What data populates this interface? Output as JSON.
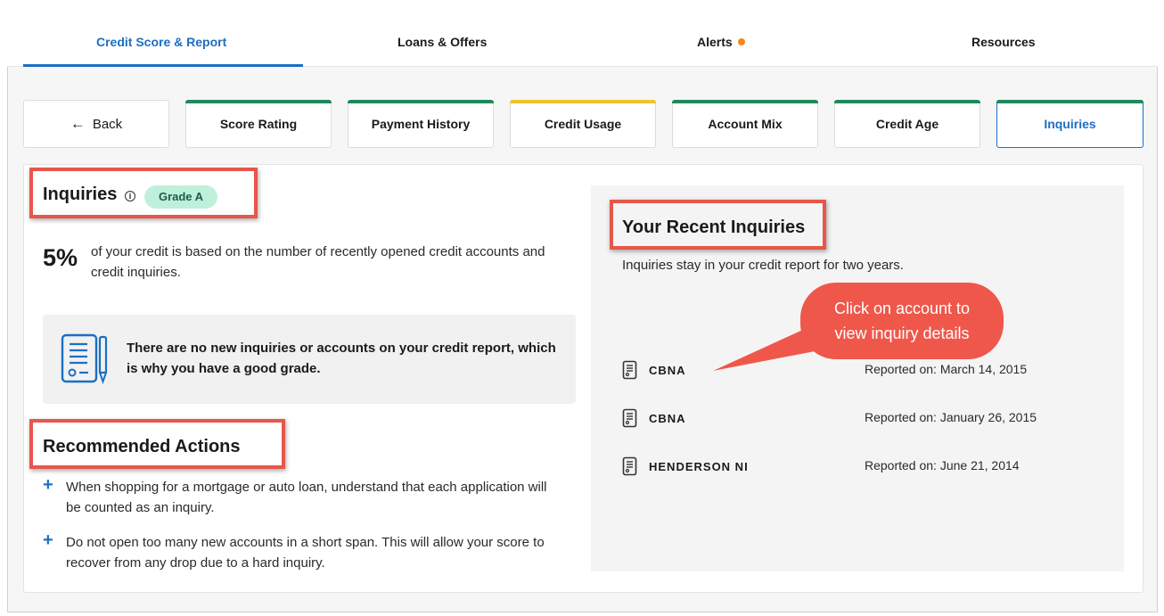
{
  "topnav": {
    "tabs": [
      {
        "label": "Credit Score & Report"
      },
      {
        "label": "Loans & Offers"
      },
      {
        "label": "Alerts"
      },
      {
        "label": "Resources"
      }
    ]
  },
  "subnav": {
    "back_label": "Back",
    "tabs": [
      {
        "label": "Score Rating"
      },
      {
        "label": "Payment History"
      },
      {
        "label": "Credit Usage"
      },
      {
        "label": "Account Mix"
      },
      {
        "label": "Credit Age"
      },
      {
        "label": "Inquiries"
      }
    ]
  },
  "inquiries": {
    "title": "Inquiries",
    "grade": "Grade A",
    "percent": "5%",
    "percent_desc": "of your credit is based on the number of recently opened credit accounts and credit inquiries.",
    "note": "There are no new inquiries or accounts on your credit report, which is why you have a good grade."
  },
  "recommended": {
    "title": "Recommended Actions",
    "items": [
      "When shopping for a mortgage or auto loan, understand that each application will be counted as an inquiry.",
      "Do not open too many new accounts in a short span. This will allow your score to recover from any drop due to a hard inquiry."
    ]
  },
  "recent": {
    "title": "Your Recent Inquiries",
    "subtitle": "Inquiries stay in your credit report for two years.",
    "items": [
      {
        "name": "CBNA",
        "reported": "Reported on: March 14, 2015"
      },
      {
        "name": "CBNA",
        "reported": "Reported on: January 26, 2015"
      },
      {
        "name": "HENDERSON NI",
        "reported": "Reported on: June 21, 2014"
      }
    ]
  },
  "callout": {
    "text_line1": "Click on account to",
    "text_line2": "view inquiry details"
  },
  "colors": {
    "accent": "#1b6fc4",
    "alert_dot": "#f08a1a",
    "annotation_red": "#e8564a",
    "grade_bg": "#bff0dc",
    "tab_green": "#1f8a5a",
    "tab_yellow": "#f2c230"
  }
}
